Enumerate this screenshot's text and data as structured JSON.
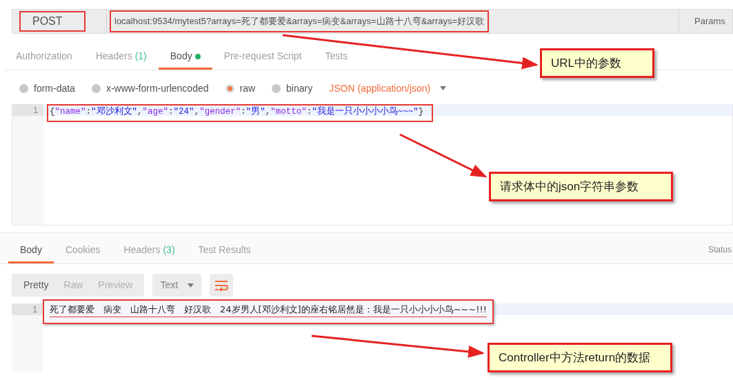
{
  "request": {
    "method": "POST",
    "url": "localhost:9534/mytest5?arrays=死了都要爱&arrays=病变&arrays=山路十八弯&arrays=好汉歌",
    "params_label": "Params"
  },
  "request_tabs": [
    {
      "label": "Authorization",
      "selected": false
    },
    {
      "label": "Headers",
      "count": "(1)",
      "selected": false
    },
    {
      "label": "Body",
      "dot": true,
      "selected": true
    },
    {
      "label": "Pre-request Script",
      "selected": false
    },
    {
      "label": "Tests",
      "selected": false
    }
  ],
  "body_types": [
    {
      "label": "form-data",
      "selected": false
    },
    {
      "label": "x-www-form-urlencoded",
      "selected": false
    },
    {
      "label": "raw",
      "selected": true
    },
    {
      "label": "binary",
      "selected": false
    }
  ],
  "content_type": "JSON (application/json)",
  "body_lines": [
    {
      "number": "1",
      "tokens": [
        {
          "kind": "punct",
          "text": "{"
        },
        {
          "kind": "key",
          "text": "\"name\""
        },
        {
          "kind": "punct",
          "text": ":"
        },
        {
          "kind": "string",
          "text": "\"邓沙利文\""
        },
        {
          "kind": "punct",
          "text": ","
        },
        {
          "kind": "key",
          "text": "\"age\""
        },
        {
          "kind": "punct",
          "text": ":"
        },
        {
          "kind": "string",
          "text": "\"24\""
        },
        {
          "kind": "punct",
          "text": ","
        },
        {
          "kind": "key",
          "text": "\"gender\""
        },
        {
          "kind": "punct",
          "text": ":"
        },
        {
          "kind": "string",
          "text": "\"男\""
        },
        {
          "kind": "punct",
          "text": ","
        },
        {
          "kind": "key",
          "text": "\"motto\""
        },
        {
          "kind": "punct",
          "text": ":"
        },
        {
          "kind": "string",
          "text": "\"我是一只小小小小鸟~~~\""
        },
        {
          "kind": "punct",
          "text": "}"
        }
      ]
    }
  ],
  "response_tabs": [
    {
      "label": "Body",
      "selected": true
    },
    {
      "label": "Cookies",
      "selected": false
    },
    {
      "label": "Headers",
      "count": "(3)",
      "selected": false
    },
    {
      "label": "Test Results",
      "selected": false
    }
  ],
  "status_label": "Status",
  "view_modes": [
    {
      "label": "Pretty",
      "selected": true
    },
    {
      "label": "Raw",
      "selected": false
    },
    {
      "label": "Preview",
      "selected": false
    }
  ],
  "format": "Text",
  "response_lines": [
    {
      "number": "1",
      "text": "死了都要爱　病变　山路十八弯　好汉歌　24岁男人[邓沙利文]的座右铭居然是：我是一只小小小小鸟~~~!!!"
    }
  ],
  "callouts": [
    {
      "text": "URL中的参数"
    },
    {
      "text": "请求体中的json字符串参数"
    },
    {
      "text": "Controller中方法return的数据"
    }
  ]
}
